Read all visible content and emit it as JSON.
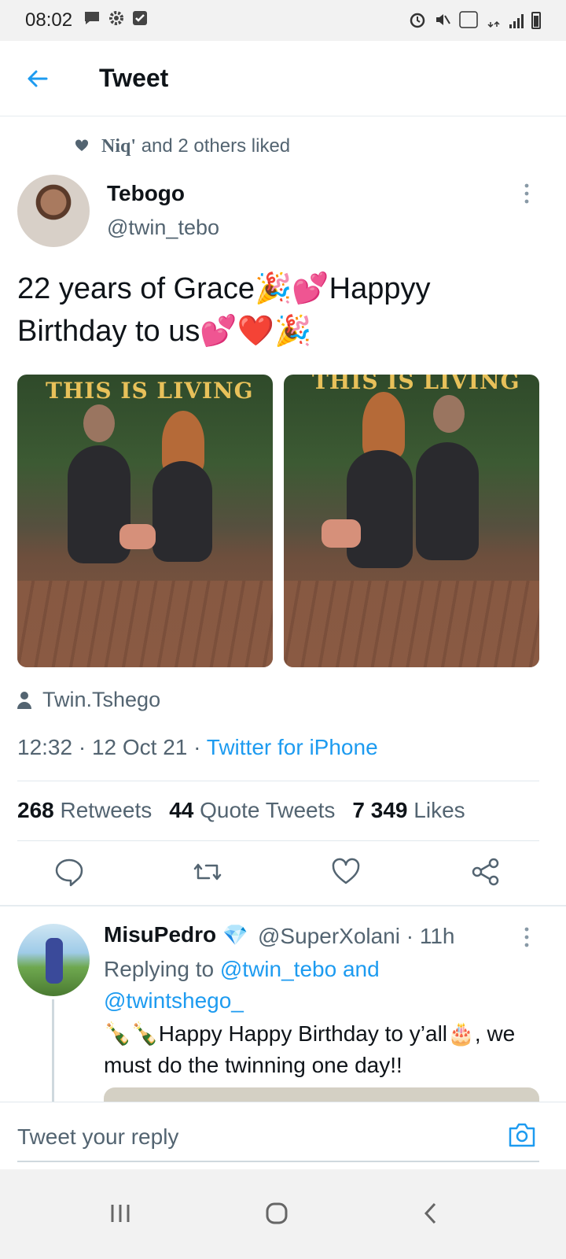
{
  "status_bar": {
    "time": "08:02"
  },
  "header": {
    "back_label": "←",
    "title": "Tweet"
  },
  "social_context": {
    "liker": "Niq'",
    "text": "and 2 others liked"
  },
  "tweet": {
    "author_name": "Tebogo",
    "author_handle": "@twin_tebo",
    "more_label": "⋮",
    "text": "22 years of Grace🎉💕Happyy Birthday to us💕❤️🎉",
    "photo_signs": [
      "THIS IS LIVING",
      "THIS IS LIVING"
    ],
    "tagged_user": "Twin.Tshego",
    "time": "12:32",
    "date": "12 Oct 21",
    "separator": "·",
    "source": "Twitter for iPhone"
  },
  "stats": {
    "retweets_count": "268",
    "retweets_label": "Retweets",
    "quotes_count": "44",
    "quotes_label": "Quote Tweets",
    "likes_count": "7 349",
    "likes_label": "Likes"
  },
  "actions": [
    "reply-icon",
    "retweet-icon",
    "like-icon",
    "share-icon"
  ],
  "reply": {
    "author_name": "MisuPedro",
    "verified_badge": "💎",
    "author_handle": "@SuperXolani · 11h",
    "more_label": "⋮",
    "replying_prefix": "Replying to",
    "mention_1": "@twin_tebo and",
    "mention_2": "@twintshego_",
    "text": "🍾🍾Happy Happy Birthday to y’all🎂, we must do the twinning one day!!"
  },
  "composer": {
    "placeholder": "Tweet your reply"
  },
  "nav_bar": {
    "recent_label": "|||",
    "home_label": "◯",
    "back_label": "‹"
  },
  "colors": {
    "accent": "#1d9bf0",
    "secondary_text": "#536471"
  }
}
